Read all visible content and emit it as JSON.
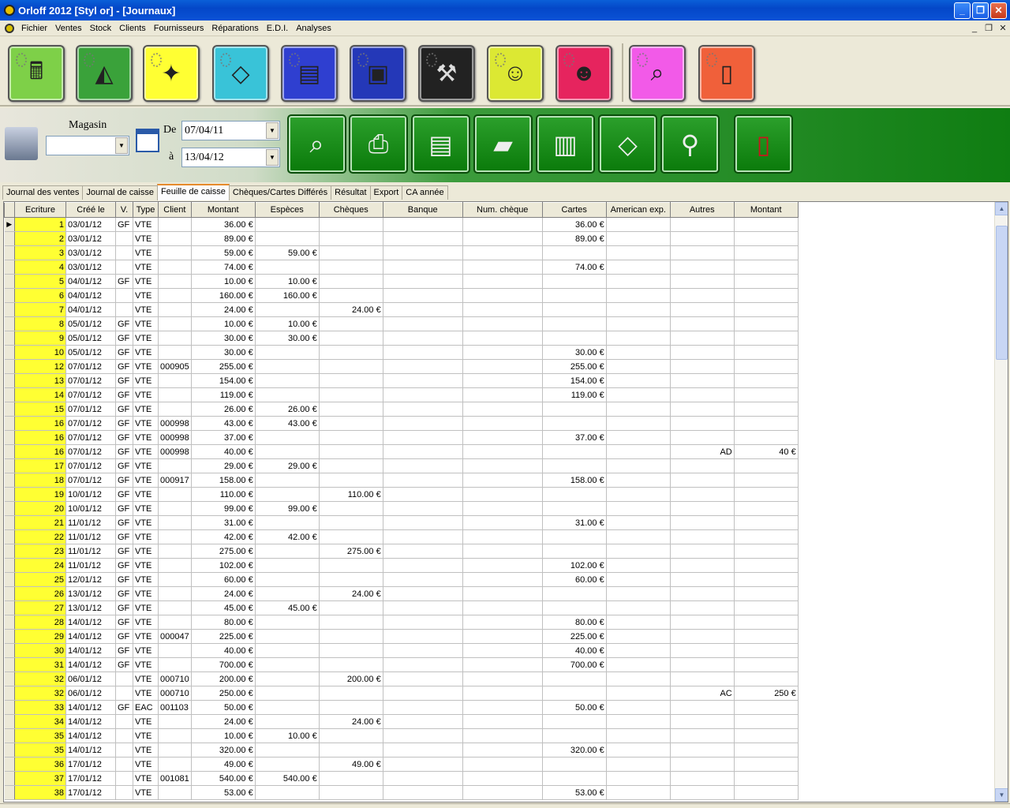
{
  "window": {
    "title": "Orloff 2012 [Styl or] - [Journaux]",
    "minimize": "_",
    "maximize": "❐",
    "close": "✕"
  },
  "menu": [
    "Fichier",
    "Ventes",
    "Stock",
    "Clients",
    "Fournisseurs",
    "Réparations",
    "E.D.I.",
    "Analyses"
  ],
  "toolbar1": [
    {
      "name": "cash-register-icon",
      "glyph": "🖩",
      "color": "#7ed048"
    },
    {
      "name": "pyramid-icon",
      "glyph": "◭",
      "color": "#3aa23a"
    },
    {
      "name": "gold-jewelry-icon",
      "glyph": "✦",
      "color": "#ffff33"
    },
    {
      "name": "diamond-icon",
      "glyph": "◇",
      "color": "#39c3d8"
    },
    {
      "name": "order-form-icon",
      "glyph": "▤",
      "color": "#2f3fd0"
    },
    {
      "name": "safe-icon",
      "glyph": "▣",
      "color": "#2438b8"
    },
    {
      "name": "toolbox-icon",
      "glyph": "⚒",
      "color": "#222222"
    },
    {
      "name": "clients-icon",
      "glyph": "☺",
      "color": "#dce833"
    },
    {
      "name": "group-icon",
      "glyph": "☻",
      "color": "#e6245e"
    },
    {
      "name": "analysis-magnifier-icon",
      "glyph": "⌕",
      "color": "#f25ae8"
    },
    {
      "name": "exit-door-icon",
      "glyph": "▯",
      "color": "#f0603a"
    }
  ],
  "filters": {
    "magasin_label": "Magasin",
    "magasin_value": "",
    "from_label": "De",
    "from_date": "07/04/11",
    "to_label": "à",
    "to_date": "13/04/12"
  },
  "toolbar2": [
    {
      "name": "search-magnifier-icon",
      "glyph": "⌕"
    },
    {
      "name": "printer-icon",
      "glyph": "⎙"
    },
    {
      "name": "print-form-icon",
      "glyph": "▤"
    },
    {
      "name": "folder-lock-icon",
      "glyph": "▰"
    },
    {
      "name": "shredder-icon",
      "glyph": "▥"
    },
    {
      "name": "diamond-binoculars-icon",
      "glyph": "◇"
    },
    {
      "name": "binoculars-icon",
      "glyph": "⚲"
    },
    {
      "name": "exit-door-icon",
      "glyph": "▯"
    }
  ],
  "tabs": [
    "Journal des ventes",
    "Journal de caisse",
    "Feuille de caisse",
    "Chèques/Cartes Différés",
    "Résultat",
    "Export",
    "CA année"
  ],
  "active_tab": 2,
  "columns": [
    "Ecriture",
    "Créé le",
    "V.",
    "Type",
    "Client",
    "Montant",
    "Espèces",
    "Chèques",
    "Banque",
    "Num. chèque",
    "Cartes",
    "American exp.",
    "Autres",
    "Montant"
  ],
  "rows": [
    [
      "1",
      "03/01/12",
      "GF",
      "VTE",
      "",
      "36.00 €",
      "",
      "",
      "",
      "",
      "36.00 €",
      "",
      "",
      ""
    ],
    [
      "2",
      "03/01/12",
      "",
      "VTE",
      "",
      "89.00 €",
      "",
      "",
      "",
      "",
      "89.00 €",
      "",
      "",
      ""
    ],
    [
      "3",
      "03/01/12",
      "",
      "VTE",
      "",
      "59.00 €",
      "59.00 €",
      "",
      "",
      "",
      "",
      "",
      "",
      ""
    ],
    [
      "4",
      "03/01/12",
      "",
      "VTE",
      "",
      "74.00 €",
      "",
      "",
      "",
      "",
      "74.00 €",
      "",
      "",
      ""
    ],
    [
      "5",
      "04/01/12",
      "GF",
      "VTE",
      "",
      "10.00 €",
      "10.00 €",
      "",
      "",
      "",
      "",
      "",
      "",
      ""
    ],
    [
      "6",
      "04/01/12",
      "",
      "VTE",
      "",
      "160.00 €",
      "160.00 €",
      "",
      "",
      "",
      "",
      "",
      "",
      ""
    ],
    [
      "7",
      "04/01/12",
      "",
      "VTE",
      "",
      "24.00 €",
      "",
      "24.00 €",
      "",
      "",
      "",
      "",
      "",
      ""
    ],
    [
      "8",
      "05/01/12",
      "GF",
      "VTE",
      "",
      "10.00 €",
      "10.00 €",
      "",
      "",
      "",
      "",
      "",
      "",
      ""
    ],
    [
      "9",
      "05/01/12",
      "GF",
      "VTE",
      "",
      "30.00 €",
      "30.00 €",
      "",
      "",
      "",
      "",
      "",
      "",
      ""
    ],
    [
      "10",
      "05/01/12",
      "GF",
      "VTE",
      "",
      "30.00 €",
      "",
      "",
      "",
      "",
      "30.00 €",
      "",
      "",
      ""
    ],
    [
      "12",
      "07/01/12",
      "GF",
      "VTE",
      "000905",
      "255.00 €",
      "",
      "",
      "",
      "",
      "255.00 €",
      "",
      "",
      ""
    ],
    [
      "13",
      "07/01/12",
      "GF",
      "VTE",
      "",
      "154.00 €",
      "",
      "",
      "",
      "",
      "154.00 €",
      "",
      "",
      ""
    ],
    [
      "14",
      "07/01/12",
      "GF",
      "VTE",
      "",
      "119.00 €",
      "",
      "",
      "",
      "",
      "119.00 €",
      "",
      "",
      ""
    ],
    [
      "15",
      "07/01/12",
      "GF",
      "VTE",
      "",
      "26.00 €",
      "26.00 €",
      "",
      "",
      "",
      "",
      "",
      "",
      ""
    ],
    [
      "16",
      "07/01/12",
      "GF",
      "VTE",
      "000998",
      "43.00 €",
      "43.00 €",
      "",
      "",
      "",
      "",
      "",
      "",
      ""
    ],
    [
      "16",
      "07/01/12",
      "GF",
      "VTE",
      "000998",
      "37.00 €",
      "",
      "",
      "",
      "",
      "37.00 €",
      "",
      "",
      ""
    ],
    [
      "16",
      "07/01/12",
      "GF",
      "VTE",
      "000998",
      "40.00 €",
      "",
      "",
      "",
      "",
      "",
      "",
      "AD",
      "40 €"
    ],
    [
      "17",
      "07/01/12",
      "GF",
      "VTE",
      "",
      "29.00 €",
      "29.00 €",
      "",
      "",
      "",
      "",
      "",
      "",
      ""
    ],
    [
      "18",
      "07/01/12",
      "GF",
      "VTE",
      "000917",
      "158.00 €",
      "",
      "",
      "",
      "",
      "158.00 €",
      "",
      "",
      ""
    ],
    [
      "19",
      "10/01/12",
      "GF",
      "VTE",
      "",
      "110.00 €",
      "",
      "110.00 €",
      "",
      "",
      "",
      "",
      "",
      ""
    ],
    [
      "20",
      "10/01/12",
      "GF",
      "VTE",
      "",
      "99.00 €",
      "99.00 €",
      "",
      "",
      "",
      "",
      "",
      "",
      ""
    ],
    [
      "21",
      "11/01/12",
      "GF",
      "VTE",
      "",
      "31.00 €",
      "",
      "",
      "",
      "",
      "31.00 €",
      "",
      "",
      ""
    ],
    [
      "22",
      "11/01/12",
      "GF",
      "VTE",
      "",
      "42.00 €",
      "42.00 €",
      "",
      "",
      "",
      "",
      "",
      "",
      ""
    ],
    [
      "23",
      "11/01/12",
      "GF",
      "VTE",
      "",
      "275.00 €",
      "",
      "275.00 €",
      "",
      "",
      "",
      "",
      "",
      ""
    ],
    [
      "24",
      "11/01/12",
      "GF",
      "VTE",
      "",
      "102.00 €",
      "",
      "",
      "",
      "",
      "102.00 €",
      "",
      "",
      ""
    ],
    [
      "25",
      "12/01/12",
      "GF",
      "VTE",
      "",
      "60.00 €",
      "",
      "",
      "",
      "",
      "60.00 €",
      "",
      "",
      ""
    ],
    [
      "26",
      "13/01/12",
      "GF",
      "VTE",
      "",
      "24.00 €",
      "",
      "24.00 €",
      "",
      "",
      "",
      "",
      "",
      ""
    ],
    [
      "27",
      "13/01/12",
      "GF",
      "VTE",
      "",
      "45.00 €",
      "45.00 €",
      "",
      "",
      "",
      "",
      "",
      "",
      ""
    ],
    [
      "28",
      "14/01/12",
      "GF",
      "VTE",
      "",
      "80.00 €",
      "",
      "",
      "",
      "",
      "80.00 €",
      "",
      "",
      ""
    ],
    [
      "29",
      "14/01/12",
      "GF",
      "VTE",
      "000047",
      "225.00 €",
      "",
      "",
      "",
      "",
      "225.00 €",
      "",
      "",
      ""
    ],
    [
      "30",
      "14/01/12",
      "GF",
      "VTE",
      "",
      "40.00 €",
      "",
      "",
      "",
      "",
      "40.00 €",
      "",
      "",
      ""
    ],
    [
      "31",
      "14/01/12",
      "GF",
      "VTE",
      "",
      "700.00 €",
      "",
      "",
      "",
      "",
      "700.00 €",
      "",
      "",
      ""
    ],
    [
      "32",
      "06/01/12",
      "",
      "VTE",
      "000710",
      "200.00 €",
      "",
      "200.00 €",
      "",
      "",
      "",
      "",
      "",
      ""
    ],
    [
      "32",
      "06/01/12",
      "",
      "VTE",
      "000710",
      "250.00 €",
      "",
      "",
      "",
      "",
      "",
      "",
      "AC",
      "250 €"
    ],
    [
      "33",
      "14/01/12",
      "GF",
      "EAC",
      "001103",
      "50.00 €",
      "",
      "",
      "",
      "",
      "50.00 €",
      "",
      "",
      ""
    ],
    [
      "34",
      "14/01/12",
      "",
      "VTE",
      "",
      "24.00 €",
      "",
      "24.00 €",
      "",
      "",
      "",
      "",
      "",
      ""
    ],
    [
      "35",
      "14/01/12",
      "",
      "VTE",
      "",
      "10.00 €",
      "10.00 €",
      "",
      "",
      "",
      "",
      "",
      "",
      ""
    ],
    [
      "35",
      "14/01/12",
      "",
      "VTE",
      "",
      "320.00 €",
      "",
      "",
      "",
      "",
      "320.00 €",
      "",
      "",
      ""
    ],
    [
      "36",
      "17/01/12",
      "",
      "VTE",
      "",
      "49.00 €",
      "",
      "49.00 €",
      "",
      "",
      "",
      "",
      "",
      ""
    ],
    [
      "37",
      "17/01/12",
      "",
      "VTE",
      "001081",
      "540.00 €",
      "540.00 €",
      "",
      "",
      "",
      "",
      "",
      "",
      ""
    ],
    [
      "38",
      "17/01/12",
      "",
      "VTE",
      "",
      "53.00 €",
      "",
      "",
      "",
      "",
      "53.00 €",
      "",
      "",
      ""
    ]
  ],
  "row_indicator": "▶",
  "scroll": {
    "up": "▲",
    "down": "▼"
  }
}
